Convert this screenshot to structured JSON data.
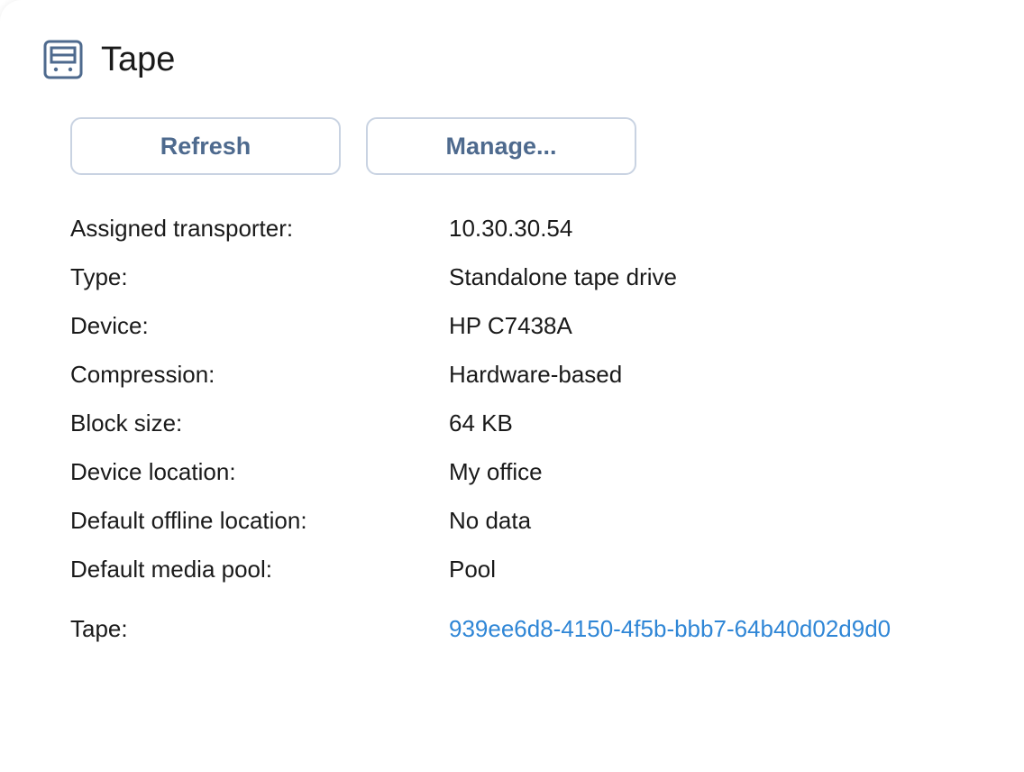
{
  "header": {
    "title": "Tape",
    "icon": "tape-drive-icon"
  },
  "toolbar": {
    "refresh_label": "Refresh",
    "manage_label": "Manage..."
  },
  "colors": {
    "accent": "#4e6a8e",
    "link": "#2f86d6",
    "button_border": "#c9d3e2"
  },
  "properties": [
    {
      "label": "Assigned transporter:",
      "value": "10.30.30.54"
    },
    {
      "label": "Type:",
      "value": "Standalone tape drive"
    },
    {
      "label": "Device:",
      "value": "HP C7438A"
    },
    {
      "label": "Compression:",
      "value": "Hardware-based"
    },
    {
      "label": "Block size:",
      "value": "64 KB"
    },
    {
      "label": "Device location:",
      "value": "My office"
    },
    {
      "label": "Default offline location:",
      "value": "No data"
    },
    {
      "label": "Default media pool:",
      "value": "Pool"
    }
  ],
  "tape": {
    "label": "Tape:",
    "value": "939ee6d8-4150-4f5b-bbb7-64b40d02d9d0"
  }
}
